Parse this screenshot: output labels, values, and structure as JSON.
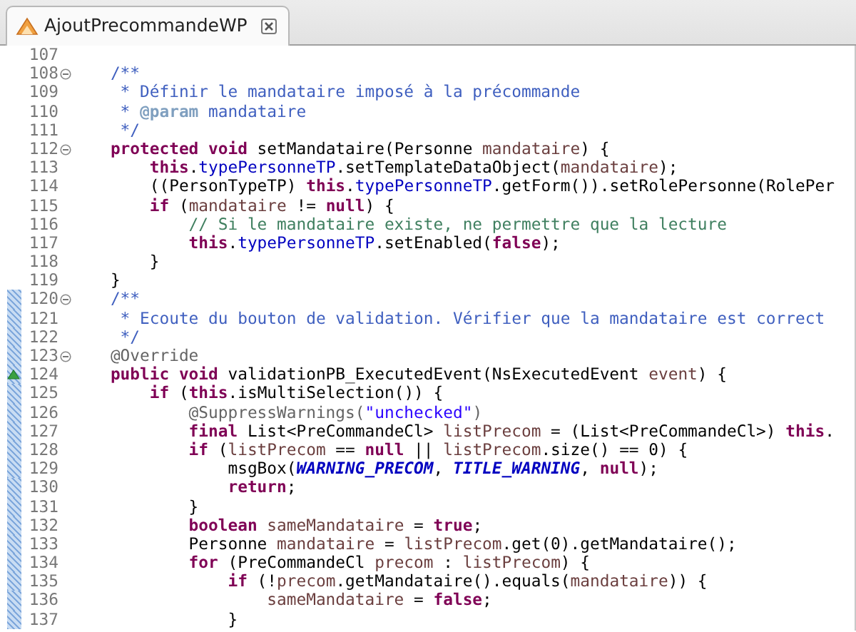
{
  "tab": {
    "title": "AjoutPrecommandeWP",
    "selected": true
  },
  "lines": [
    {
      "number": "107",
      "foldable": false,
      "changed": false,
      "override": false
    },
    {
      "number": "108",
      "foldable": true,
      "changed": false,
      "override": false,
      "tokens": [
        {
          "kind": "javadoc",
          "text": "    /**"
        }
      ]
    },
    {
      "number": "109",
      "foldable": false,
      "changed": false,
      "override": false,
      "tokens": [
        {
          "kind": "javadoc",
          "text": "     * Définir le mandataire imposé à la précommande"
        }
      ]
    },
    {
      "number": "110",
      "foldable": false,
      "changed": false,
      "override": false,
      "tokens": [
        {
          "kind": "javadoc",
          "text": "     * "
        },
        {
          "kind": "javadoc-tag",
          "text": "@param"
        },
        {
          "kind": "javadoc",
          "text": " mandataire"
        }
      ]
    },
    {
      "number": "111",
      "foldable": false,
      "changed": false,
      "override": false,
      "tokens": [
        {
          "kind": "javadoc",
          "text": "     */"
        }
      ]
    },
    {
      "number": "112",
      "foldable": true,
      "changed": false,
      "override": false,
      "tokens": [
        {
          "kind": "keyword",
          "text": "    protected void"
        },
        {
          "kind": "plain",
          "text": " setMandataire(Personne "
        },
        {
          "kind": "variable",
          "text": "mandataire"
        },
        {
          "kind": "plain",
          "text": ") {"
        }
      ]
    },
    {
      "number": "113",
      "foldable": false,
      "changed": false,
      "override": false,
      "tokens": [
        {
          "kind": "keyword",
          "text": "        this"
        },
        {
          "kind": "plain",
          "text": "."
        },
        {
          "kind": "field",
          "text": "typePersonneTP"
        },
        {
          "kind": "plain",
          "text": ".setTemplateDataObject("
        },
        {
          "kind": "variable",
          "text": "mandataire"
        },
        {
          "kind": "plain",
          "text": ");"
        }
      ]
    },
    {
      "number": "114",
      "foldable": false,
      "changed": false,
      "override": false,
      "tokens": [
        {
          "kind": "plain",
          "text": "        ((PersonTypeTP) "
        },
        {
          "kind": "keyword",
          "text": "this"
        },
        {
          "kind": "plain",
          "text": "."
        },
        {
          "kind": "field",
          "text": "typePersonneTP"
        },
        {
          "kind": "plain",
          "text": ".getForm()).setRolePersonne(RolePer"
        }
      ]
    },
    {
      "number": "115",
      "foldable": false,
      "changed": false,
      "override": false,
      "tokens": [
        {
          "kind": "keyword",
          "text": "        if"
        },
        {
          "kind": "plain",
          "text": " ("
        },
        {
          "kind": "variable",
          "text": "mandataire"
        },
        {
          "kind": "plain",
          "text": " != "
        },
        {
          "kind": "keyword",
          "text": "null"
        },
        {
          "kind": "plain",
          "text": ") {"
        }
      ]
    },
    {
      "number": "116",
      "foldable": false,
      "changed": false,
      "override": false,
      "tokens": [
        {
          "kind": "comment",
          "text": "            // Si le mandataire existe, ne permettre que la lecture"
        }
      ]
    },
    {
      "number": "117",
      "foldable": false,
      "changed": false,
      "override": false,
      "tokens": [
        {
          "kind": "keyword",
          "text": "            this"
        },
        {
          "kind": "plain",
          "text": "."
        },
        {
          "kind": "field",
          "text": "typePersonneTP"
        },
        {
          "kind": "plain",
          "text": ".setEnabled("
        },
        {
          "kind": "keyword",
          "text": "false"
        },
        {
          "kind": "plain",
          "text": ");"
        }
      ]
    },
    {
      "number": "118",
      "foldable": false,
      "changed": false,
      "override": false,
      "tokens": [
        {
          "kind": "plain",
          "text": "        }"
        }
      ]
    },
    {
      "number": "119",
      "foldable": false,
      "changed": false,
      "override": false,
      "tokens": [
        {
          "kind": "plain",
          "text": "    }"
        }
      ]
    },
    {
      "number": "120",
      "foldable": true,
      "changed": true,
      "override": false,
      "tokens": [
        {
          "kind": "javadoc",
          "text": "    /**"
        }
      ]
    },
    {
      "number": "121",
      "foldable": false,
      "changed": true,
      "override": false,
      "tokens": [
        {
          "kind": "javadoc",
          "text": "     * Ecoute du bouton de validation. Vérifier que la mandataire est correct"
        }
      ]
    },
    {
      "number": "122",
      "foldable": false,
      "changed": true,
      "override": false,
      "tokens": [
        {
          "kind": "javadoc",
          "text": "     */"
        }
      ]
    },
    {
      "number": "123",
      "foldable": true,
      "changed": true,
      "override": false,
      "tokens": [
        {
          "kind": "annotation",
          "text": "    @Override"
        }
      ]
    },
    {
      "number": "124",
      "foldable": false,
      "changed": true,
      "override": true,
      "tokens": [
        {
          "kind": "keyword",
          "text": "    public void"
        },
        {
          "kind": "plain",
          "text": " validationPB_ExecutedEvent(NsExecutedEvent "
        },
        {
          "kind": "variable",
          "text": "event"
        },
        {
          "kind": "plain",
          "text": ") {"
        }
      ]
    },
    {
      "number": "125",
      "foldable": false,
      "changed": true,
      "override": false,
      "tokens": [
        {
          "kind": "keyword",
          "text": "        if"
        },
        {
          "kind": "plain",
          "text": " ("
        },
        {
          "kind": "keyword",
          "text": "this"
        },
        {
          "kind": "plain",
          "text": ".isMultiSelection()) {"
        }
      ]
    },
    {
      "number": "126",
      "foldable": false,
      "changed": true,
      "override": false,
      "tokens": [
        {
          "kind": "annotation",
          "text": "            @SuppressWarnings("
        },
        {
          "kind": "string",
          "text": "\"unchecked\""
        },
        {
          "kind": "annotation",
          "text": ")"
        }
      ]
    },
    {
      "number": "127",
      "foldable": false,
      "changed": true,
      "override": false,
      "tokens": [
        {
          "kind": "keyword",
          "text": "            final"
        },
        {
          "kind": "plain",
          "text": " List<PreCommandeCl> "
        },
        {
          "kind": "variable",
          "text": "listPrecom"
        },
        {
          "kind": "plain",
          "text": " = (List<PreCommandeCl>) "
        },
        {
          "kind": "keyword",
          "text": "this"
        },
        {
          "kind": "plain",
          "text": "."
        }
      ]
    },
    {
      "number": "128",
      "foldable": false,
      "changed": true,
      "override": false,
      "tokens": [
        {
          "kind": "keyword",
          "text": "            if"
        },
        {
          "kind": "plain",
          "text": " ("
        },
        {
          "kind": "variable",
          "text": "listPrecom"
        },
        {
          "kind": "plain",
          "text": " == "
        },
        {
          "kind": "keyword",
          "text": "null"
        },
        {
          "kind": "plain",
          "text": " || "
        },
        {
          "kind": "variable",
          "text": "listPrecom"
        },
        {
          "kind": "plain",
          "text": ".size() == 0) {"
        }
      ]
    },
    {
      "number": "129",
      "foldable": false,
      "changed": true,
      "override": false,
      "tokens": [
        {
          "kind": "plain",
          "text": "                msgBox("
        },
        {
          "kind": "constant",
          "text": "WARNING_PRECOM"
        },
        {
          "kind": "plain",
          "text": ", "
        },
        {
          "kind": "constant",
          "text": "TITLE_WARNING"
        },
        {
          "kind": "plain",
          "text": ", "
        },
        {
          "kind": "keyword",
          "text": "null"
        },
        {
          "kind": "plain",
          "text": ");"
        }
      ]
    },
    {
      "number": "130",
      "foldable": false,
      "changed": true,
      "override": false,
      "tokens": [
        {
          "kind": "keyword",
          "text": "                return"
        },
        {
          "kind": "plain",
          "text": ";"
        }
      ]
    },
    {
      "number": "131",
      "foldable": false,
      "changed": true,
      "override": false,
      "tokens": [
        {
          "kind": "plain",
          "text": "            }"
        }
      ]
    },
    {
      "number": "132",
      "foldable": false,
      "changed": true,
      "override": false,
      "tokens": [
        {
          "kind": "keyword",
          "text": "            boolean"
        },
        {
          "kind": "variable",
          "text": " sameMandataire"
        },
        {
          "kind": "plain",
          "text": " = "
        },
        {
          "kind": "keyword",
          "text": "true"
        },
        {
          "kind": "plain",
          "text": ";"
        }
      ]
    },
    {
      "number": "133",
      "foldable": false,
      "changed": true,
      "override": false,
      "tokens": [
        {
          "kind": "plain",
          "text": "            Personne "
        },
        {
          "kind": "variable",
          "text": "mandataire"
        },
        {
          "kind": "plain",
          "text": " = "
        },
        {
          "kind": "variable",
          "text": "listPrecom"
        },
        {
          "kind": "plain",
          "text": ".get(0).getMandataire();"
        }
      ]
    },
    {
      "number": "134",
      "foldable": false,
      "changed": true,
      "override": false,
      "tokens": [
        {
          "kind": "keyword",
          "text": "            for"
        },
        {
          "kind": "plain",
          "text": " (PreCommandeCl "
        },
        {
          "kind": "variable",
          "text": "precom"
        },
        {
          "kind": "plain",
          "text": " : "
        },
        {
          "kind": "variable",
          "text": "listPrecom"
        },
        {
          "kind": "plain",
          "text": ") {"
        }
      ]
    },
    {
      "number": "135",
      "foldable": false,
      "changed": true,
      "override": false,
      "tokens": [
        {
          "kind": "keyword",
          "text": "                if"
        },
        {
          "kind": "plain",
          "text": " (!"
        },
        {
          "kind": "variable",
          "text": "precom"
        },
        {
          "kind": "plain",
          "text": ".getMandataire().equals("
        },
        {
          "kind": "variable",
          "text": "mandataire"
        },
        {
          "kind": "plain",
          "text": ")) {"
        }
      ]
    },
    {
      "number": "136",
      "foldable": false,
      "changed": true,
      "override": false,
      "tokens": [
        {
          "kind": "variable",
          "text": "                    sameMandataire"
        },
        {
          "kind": "plain",
          "text": " = "
        },
        {
          "kind": "keyword",
          "text": "false"
        },
        {
          "kind": "plain",
          "text": ";"
        }
      ]
    },
    {
      "number": "137",
      "foldable": false,
      "changed": true,
      "override": false,
      "tokens": [
        {
          "kind": "plain",
          "text": "                }"
        }
      ]
    }
  ]
}
